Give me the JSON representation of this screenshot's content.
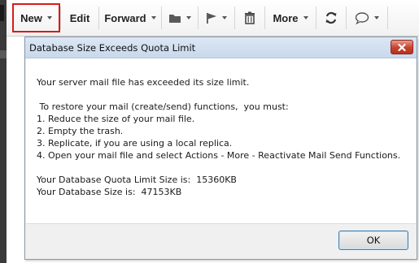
{
  "toolbar": {
    "new_label": "New",
    "edit_label": "Edit",
    "forward_label": "Forward",
    "more_label": "More",
    "icons": [
      "folder-icon",
      "flag-icon",
      "trash-icon",
      "refresh-icon",
      "chat-icon"
    ]
  },
  "dialog": {
    "title": "Database Size Exceeds Quota Limit",
    "lines": [
      "Your server mail file has exceeded its size limit.",
      " To restore your mail (create/send) functions,  you must:",
      "1. Reduce the size of your mail file.",
      "2. Empty the trash.",
      "3. Replicate, if you are using a local replica.",
      "4. Open your mail file and select Actions - More - Reactivate Mail Send Functions.",
      "Your Database Quota Limit Size is:  15360KB",
      "Your Database Size is:  47153KB"
    ],
    "ok_label": "OK"
  },
  "colors": {
    "highlight": "#d91a1a",
    "titlebar": "#c8d8ec",
    "close_button": "#c8412d",
    "ok_border": "#3c7fb1"
  }
}
